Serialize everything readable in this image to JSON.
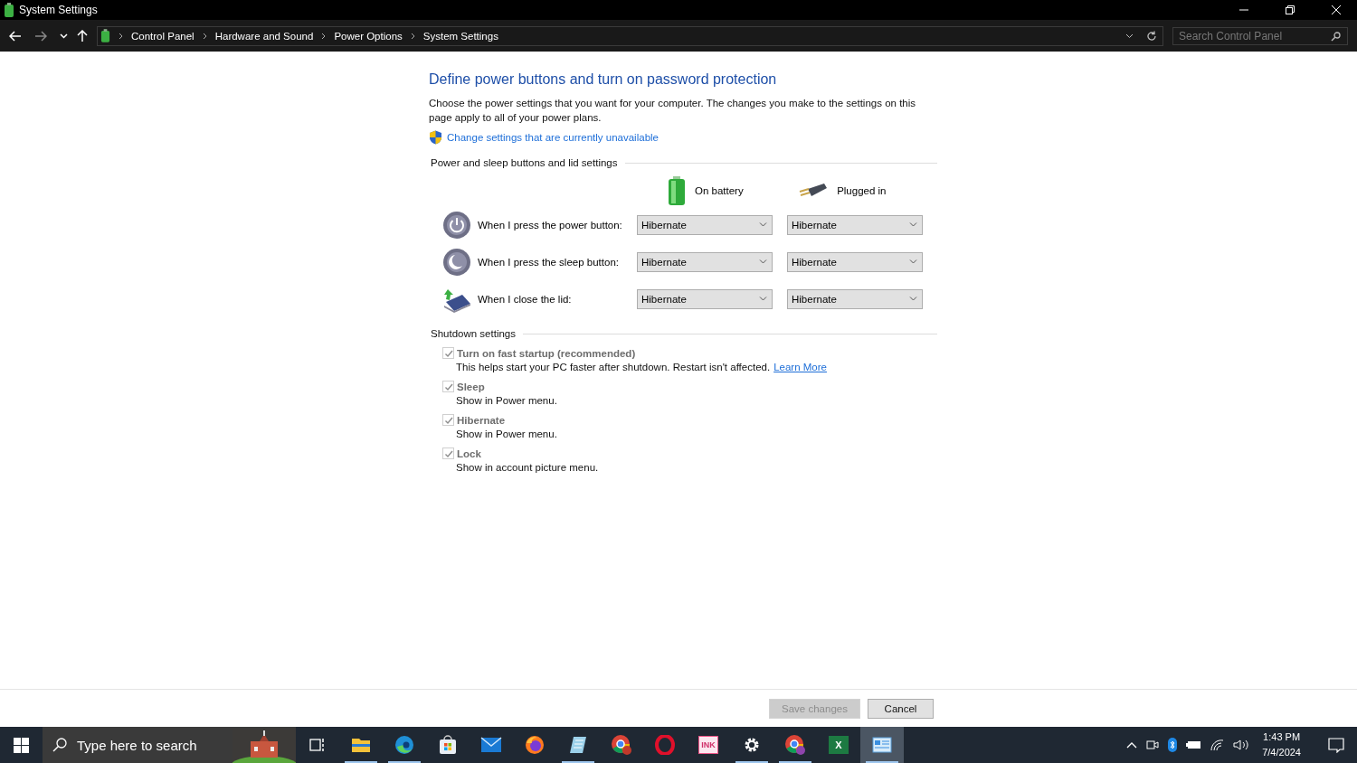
{
  "window": {
    "title": "System Settings"
  },
  "address_bar": {
    "breadcrumbs": [
      "Control Panel",
      "Hardware and Sound",
      "Power Options",
      "System Settings"
    ],
    "search_placeholder": "Search Control Panel"
  },
  "page": {
    "heading": "Define power buttons and turn on password protection",
    "intro": "Choose the power settings that you want for your computer. The changes you make to the settings on this page apply to all of your power plans.",
    "admin_link": "Change settings that are currently unavailable"
  },
  "buttons_section": {
    "title": "Power and sleep buttons and lid settings",
    "columns": [
      {
        "kind": "battery",
        "label": "On battery"
      },
      {
        "kind": "plug",
        "label": "Plugged in"
      }
    ],
    "rows": [
      {
        "kind": "power",
        "label": "When I press the power button:",
        "on_battery": "Hibernate",
        "plugged_in": "Hibernate"
      },
      {
        "kind": "sleep",
        "label": "When I press the sleep button:",
        "on_battery": "Hibernate",
        "plugged_in": "Hibernate"
      },
      {
        "kind": "lid",
        "label": "When I close the lid:",
        "on_battery": "Hibernate",
        "plugged_in": "Hibernate"
      }
    ]
  },
  "shutdown_section": {
    "title": "Shutdown settings",
    "options": [
      {
        "label": "Turn on fast startup (recommended)",
        "description": "This helps start your PC faster after shutdown. Restart isn't affected.",
        "link": "Learn More",
        "checked": true,
        "disabled": true
      },
      {
        "label": "Sleep",
        "description": "Show in Power menu.",
        "checked": true,
        "disabled": true
      },
      {
        "label": "Hibernate",
        "description": "Show in Power menu.",
        "checked": true,
        "disabled": true
      },
      {
        "label": "Lock",
        "description": "Show in account picture menu.",
        "checked": true,
        "disabled": true
      }
    ]
  },
  "footer": {
    "buttons": [
      {
        "label": "Save changes",
        "disabled": true
      },
      {
        "label": "Cancel",
        "disabled": false
      }
    ]
  },
  "taskbar": {
    "search_placeholder": "Type here to search",
    "apps": [
      {
        "kind": "taskview",
        "running": false,
        "selected": false
      },
      {
        "kind": "folder",
        "running": true,
        "selected": false
      },
      {
        "kind": "edge",
        "running": true,
        "selected": false
      },
      {
        "kind": "store",
        "running": false,
        "selected": false
      },
      {
        "kind": "mail",
        "running": false,
        "selected": false
      },
      {
        "kind": "firefox",
        "running": false,
        "selected": false
      },
      {
        "kind": "notepad",
        "running": true,
        "selected": false
      },
      {
        "kind": "chrome",
        "running": false,
        "selected": false
      },
      {
        "kind": "opera",
        "running": false,
        "selected": false
      },
      {
        "kind": "ink",
        "text": "INK",
        "running": false,
        "selected": false
      },
      {
        "kind": "gear",
        "running": true,
        "selected": false
      },
      {
        "kind": "chrome",
        "running": true,
        "selected": false
      },
      {
        "kind": "excel",
        "text": "X",
        "running": false,
        "selected": false
      },
      {
        "kind": "panel",
        "running": true,
        "selected": true
      }
    ],
    "time": "1:43 PM",
    "date": "7/4/2024"
  }
}
